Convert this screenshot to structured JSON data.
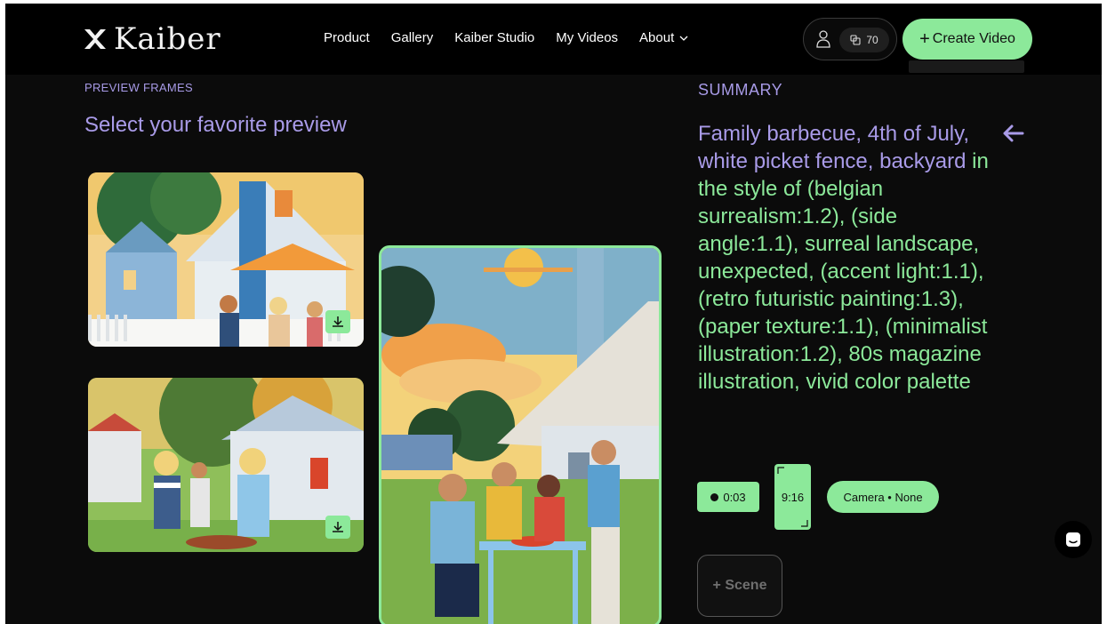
{
  "nav": {
    "logo_text": "Kaiber",
    "menu": [
      {
        "label": "Product"
      },
      {
        "label": "Gallery"
      },
      {
        "label": "Kaiber Studio"
      },
      {
        "label": "My Videos"
      },
      {
        "label": "About"
      }
    ],
    "credits": "70",
    "create_label": "Create Video"
  },
  "preview": {
    "section_label": "PREVIEW FRAMES",
    "heading": "Select your favorite preview"
  },
  "summary": {
    "label": "SUMMARY",
    "prompt_lead": "Family barbecue, 4th of July, white picket fence, backyard",
    "prompt_rest": "in the style of (belgian surrealism:1.2), (side angle:1.1), surreal landscape, unexpected, (accent light:1.1), (retro futuristic painting:1.3), (paper texture:1.1), (minimalist illustration:1.2), 80s magazine illustration, vivid color palette"
  },
  "settings": {
    "duration": "0:03",
    "aspect": "9:16",
    "camera": "Camera • None",
    "add_scene": "+ Scene"
  },
  "colors": {
    "accent_green": "#8ce99a",
    "accent_purple": "#a99be8",
    "background": "#0b0b0b"
  }
}
